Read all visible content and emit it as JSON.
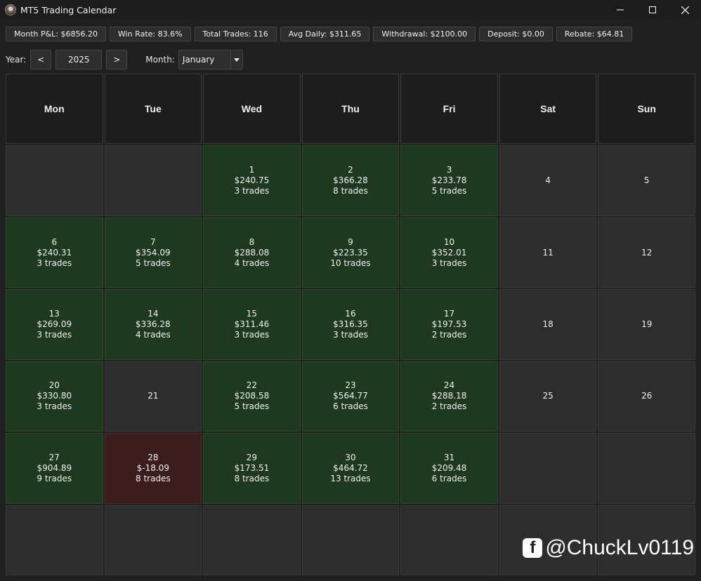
{
  "window": {
    "title": "MT5 Trading Calendar"
  },
  "stats": [
    {
      "label": "Month P&L: $6856.20"
    },
    {
      "label": "Win Rate: 83.6%"
    },
    {
      "label": "Total Trades: 116"
    },
    {
      "label": "Avg Daily: $311.65"
    },
    {
      "label": "Withdrawal: $2100.00"
    },
    {
      "label": "Deposit: $0.00"
    },
    {
      "label": "Rebate: $64.81"
    }
  ],
  "controls": {
    "year_label": "Year:",
    "prev": "<",
    "year": "2025",
    "next": ">",
    "month_label": "Month:",
    "month": "January"
  },
  "weekdays": [
    "Mon",
    "Tue",
    "Wed",
    "Thu",
    "Fri",
    "Sat",
    "Sun"
  ],
  "days": [
    {
      "day": "",
      "pnl": "",
      "trades": "",
      "status": "empty"
    },
    {
      "day": "",
      "pnl": "",
      "trades": "",
      "status": "empty"
    },
    {
      "day": "1",
      "pnl": "$240.75",
      "trades": "3 trades",
      "status": "win"
    },
    {
      "day": "2",
      "pnl": "$366.28",
      "trades": "8 trades",
      "status": "win"
    },
    {
      "day": "3",
      "pnl": "$233.78",
      "trades": "5 trades",
      "status": "win"
    },
    {
      "day": "4",
      "pnl": "",
      "trades": "",
      "status": "none"
    },
    {
      "day": "5",
      "pnl": "",
      "trades": "",
      "status": "none"
    },
    {
      "day": "6",
      "pnl": "$240.31",
      "trades": "3 trades",
      "status": "win"
    },
    {
      "day": "7",
      "pnl": "$354.09",
      "trades": "5 trades",
      "status": "win"
    },
    {
      "day": "8",
      "pnl": "$288.08",
      "trades": "4 trades",
      "status": "win"
    },
    {
      "day": "9",
      "pnl": "$223.35",
      "trades": "10 trades",
      "status": "win"
    },
    {
      "day": "10",
      "pnl": "$352.01",
      "trades": "3 trades",
      "status": "win"
    },
    {
      "day": "11",
      "pnl": "",
      "trades": "",
      "status": "none"
    },
    {
      "day": "12",
      "pnl": "",
      "trades": "",
      "status": "none"
    },
    {
      "day": "13",
      "pnl": "$269.09",
      "trades": "3 trades",
      "status": "win"
    },
    {
      "day": "14",
      "pnl": "$336.28",
      "trades": "4 trades",
      "status": "win"
    },
    {
      "day": "15",
      "pnl": "$311.46",
      "trades": "3 trades",
      "status": "win"
    },
    {
      "day": "16",
      "pnl": "$316.35",
      "trades": "3 trades",
      "status": "win"
    },
    {
      "day": "17",
      "pnl": "$197.53",
      "trades": "2 trades",
      "status": "win"
    },
    {
      "day": "18",
      "pnl": "",
      "trades": "",
      "status": "none"
    },
    {
      "day": "19",
      "pnl": "",
      "trades": "",
      "status": "none"
    },
    {
      "day": "20",
      "pnl": "$330.80",
      "trades": "3 trades",
      "status": "win"
    },
    {
      "day": "21",
      "pnl": "",
      "trades": "",
      "status": "none"
    },
    {
      "day": "22",
      "pnl": "$208.58",
      "trades": "5 trades",
      "status": "win"
    },
    {
      "day": "23",
      "pnl": "$564.77",
      "trades": "6 trades",
      "status": "win"
    },
    {
      "day": "24",
      "pnl": "$288.18",
      "trades": "2 trades",
      "status": "win"
    },
    {
      "day": "25",
      "pnl": "",
      "trades": "",
      "status": "none"
    },
    {
      "day": "26",
      "pnl": "",
      "trades": "",
      "status": "none"
    },
    {
      "day": "27",
      "pnl": "$904.89",
      "trades": "9 trades",
      "status": "win"
    },
    {
      "day": "28",
      "pnl": "$-18.09",
      "trades": "8 trades",
      "status": "loss"
    },
    {
      "day": "29",
      "pnl": "$173.51",
      "trades": "8 trades",
      "status": "win"
    },
    {
      "day": "30",
      "pnl": "$464.72",
      "trades": "13 trades",
      "status": "win"
    },
    {
      "day": "31",
      "pnl": "$209.48",
      "trades": "6 trades",
      "status": "win"
    },
    {
      "day": "",
      "pnl": "",
      "trades": "",
      "status": "empty"
    },
    {
      "day": "",
      "pnl": "",
      "trades": "",
      "status": "empty"
    },
    {
      "day": "",
      "pnl": "",
      "trades": "",
      "status": "empty"
    },
    {
      "day": "",
      "pnl": "",
      "trades": "",
      "status": "empty"
    },
    {
      "day": "",
      "pnl": "",
      "trades": "",
      "status": "empty"
    },
    {
      "day": "",
      "pnl": "",
      "trades": "",
      "status": "empty"
    },
    {
      "day": "",
      "pnl": "",
      "trades": "",
      "status": "empty"
    },
    {
      "day": "",
      "pnl": "",
      "trades": "",
      "status": "empty"
    },
    {
      "day": "",
      "pnl": "",
      "trades": "",
      "status": "empty"
    }
  ],
  "colors": {
    "win": "#1f3820",
    "loss": "#3b1d1d",
    "neutral": "#2d2d2d",
    "background": "#202020"
  },
  "watermark": {
    "handle": "@ChuckLv0119",
    "icon": "facebook-icon"
  }
}
